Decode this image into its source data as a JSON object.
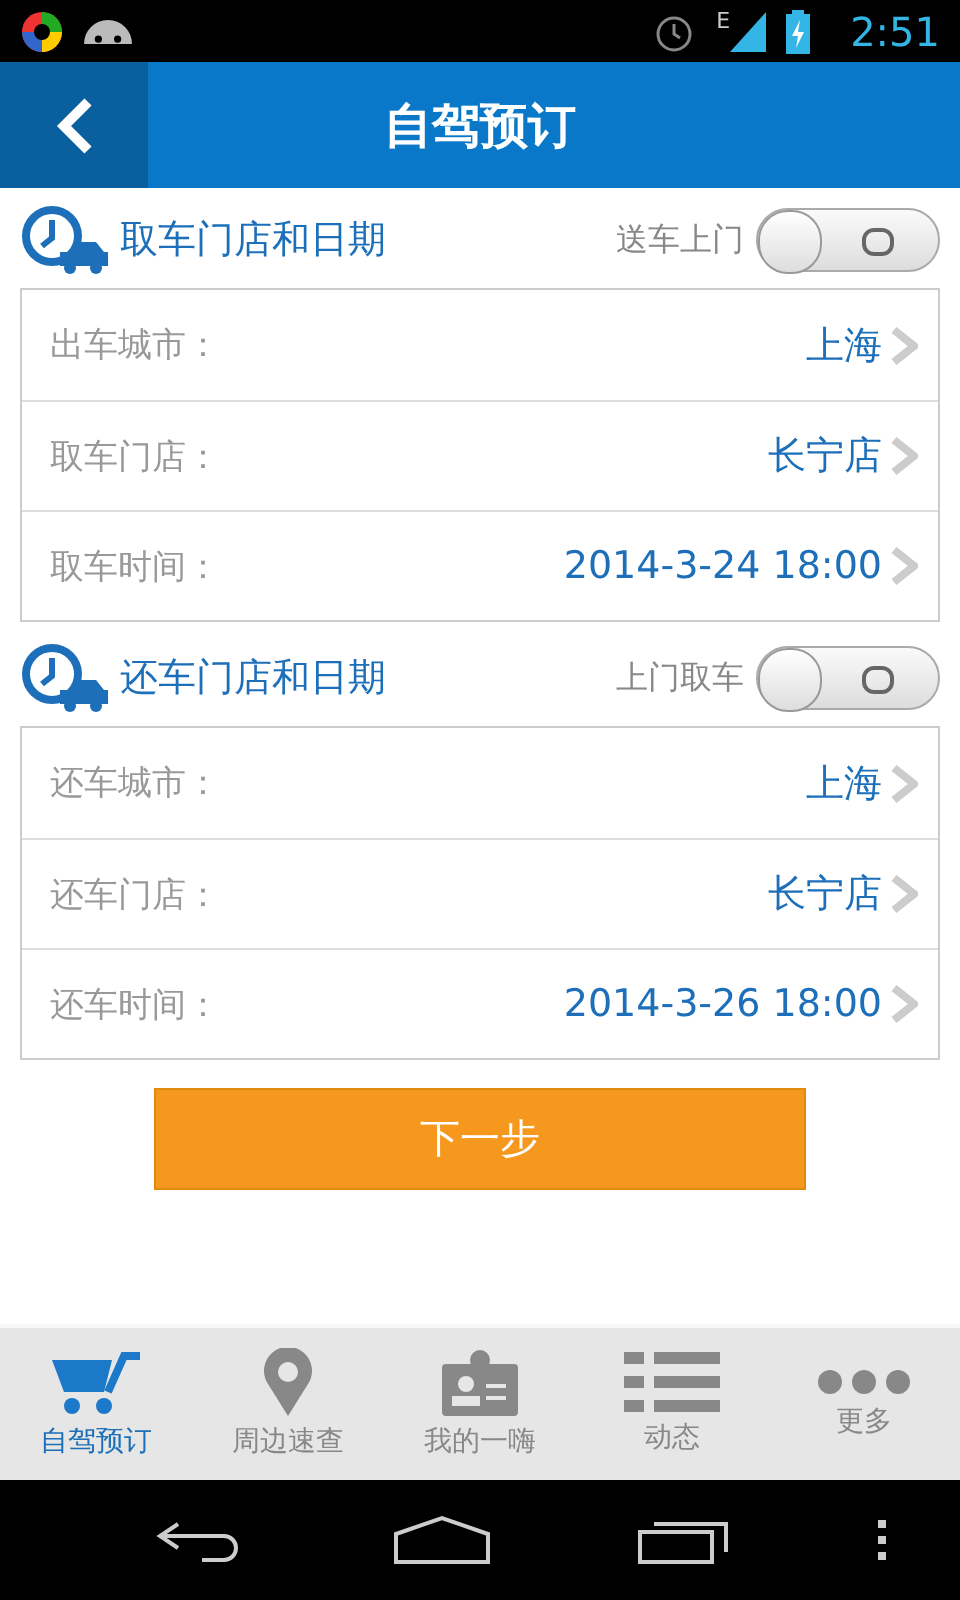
{
  "status_bar": {
    "network": "E",
    "time": "2:51"
  },
  "header": {
    "title": "自驾预订"
  },
  "sections": [
    {
      "title": "取车门店和日期",
      "toggle": {
        "label": "送车上门",
        "on": false
      },
      "rows": [
        {
          "label": "出车城市：",
          "value": "上海"
        },
        {
          "label": "取车门店：",
          "value": "长宁店"
        },
        {
          "label": "取车时间：",
          "value": "2014-3-24 18:00"
        }
      ]
    },
    {
      "title": "还车门店和日期",
      "toggle": {
        "label": "上门取车",
        "on": false
      },
      "rows": [
        {
          "label": "还车城市：",
          "value": "上海"
        },
        {
          "label": "还车门店：",
          "value": "长宁店"
        },
        {
          "label": "还车时间：",
          "value": "2014-3-26 18:00"
        }
      ]
    }
  ],
  "next_button": "下一步",
  "tabs": [
    {
      "kind": "cart",
      "label": "自驾预订",
      "selected": true
    },
    {
      "kind": "pin",
      "label": "周边速查",
      "selected": false
    },
    {
      "kind": "badge",
      "label": "我的一嗨",
      "selected": false
    },
    {
      "kind": "list",
      "label": "动态",
      "selected": false
    },
    {
      "kind": "more",
      "label": "更多",
      "selected": false
    }
  ]
}
